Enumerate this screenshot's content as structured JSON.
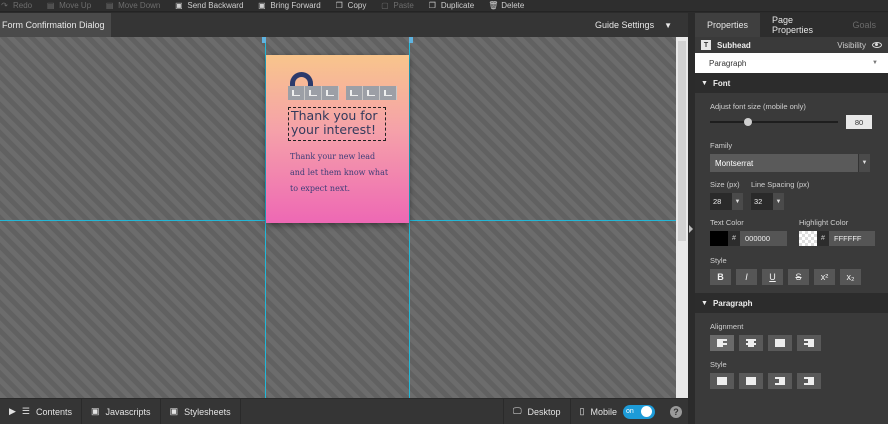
{
  "toolbar": {
    "items": [
      {
        "label": "Redo",
        "icon": "redo-icon",
        "enabled": false
      },
      {
        "label": "Move Up",
        "icon": "move-up-icon",
        "enabled": false
      },
      {
        "label": "Move Down",
        "icon": "move-down-icon",
        "enabled": false
      },
      {
        "label": "Send Backward",
        "icon": "send-backward-icon",
        "enabled": true
      },
      {
        "label": "Bring Forward",
        "icon": "bring-forward-icon",
        "enabled": true
      },
      {
        "label": "Copy",
        "icon": "copy-icon",
        "enabled": true
      },
      {
        "label": "Paste",
        "icon": "paste-icon",
        "enabled": false
      },
      {
        "label": "Duplicate",
        "icon": "duplicate-icon",
        "enabled": true
      },
      {
        "label": "Delete",
        "icon": "trash-icon",
        "enabled": true
      }
    ]
  },
  "canvas_header": {
    "title": "Form Confirmation Dialog",
    "guide_settings": "Guide Settings"
  },
  "dialog": {
    "headline": "Thank you for your interest!",
    "body": "Thank your new lead\nand let them know what\nto expect next."
  },
  "bottom_bar": {
    "contents": "Contents",
    "javascripts": "Javascripts",
    "stylesheets": "Stylesheets",
    "desktop": "Desktop",
    "mobile": "Mobile",
    "toggle_label": "on",
    "help": "?"
  },
  "panel": {
    "tabs": [
      "Properties",
      "Page Properties",
      "Goals"
    ],
    "subhead_badge": "T",
    "subhead_label": "Subhead",
    "visibility_label": "Visibility",
    "element_type": "Paragraph",
    "font_section": "Font",
    "adjust_label": "Adjust font size (mobile only)",
    "adjust_value": "80",
    "adjust_fraction": 0.3,
    "family_label": "Family",
    "family_value": "Montserrat",
    "size_label": "Size (px)",
    "size_value": "28",
    "line_spacing_label": "Line Spacing (px)",
    "line_spacing_value": "32",
    "text_color_label": "Text Color",
    "text_color_hash": "#",
    "text_color_value": "000000",
    "highlight_label": "Highlight Color",
    "highlight_hash": "#",
    "highlight_value": "FFFFFF",
    "style_label": "Style",
    "style_buttons": [
      "B",
      "I",
      "U",
      "S",
      "x²",
      "x₂"
    ],
    "paragraph_section": "Paragraph",
    "alignment_label": "Alignment",
    "para_style_label": "Style"
  },
  "colors": {
    "accent": "#1d9bd8",
    "guide_line": "#23b7d6",
    "lock_icon": "#2c3a6b",
    "text_color": "#000000",
    "highlight_color": "#FFFFFF"
  }
}
